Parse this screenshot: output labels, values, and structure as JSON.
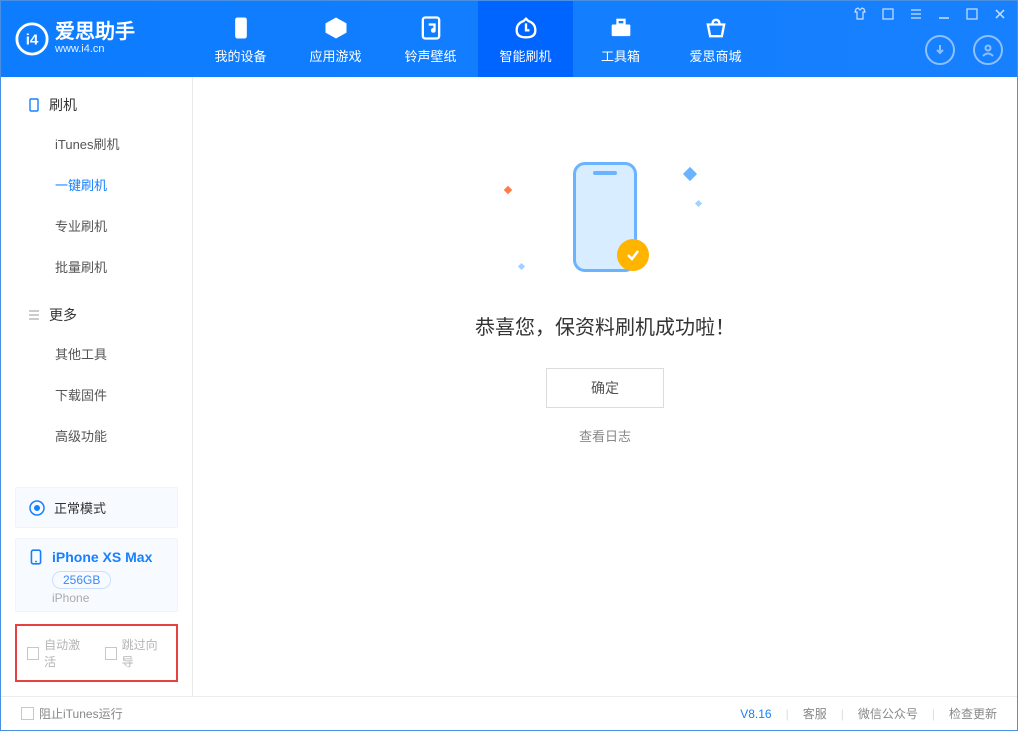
{
  "app": {
    "name_cn": "爱思助手",
    "name_en": "www.i4.cn"
  },
  "tabs": {
    "device": "我的设备",
    "apps": "应用游戏",
    "ring": "铃声壁纸",
    "flash": "智能刷机",
    "tools": "工具箱",
    "store": "爱思商城"
  },
  "sidebar": {
    "group_flash": "刷机",
    "items_flash": {
      "itunes": "iTunes刷机",
      "oneclick": "一键刷机",
      "pro": "专业刷机",
      "batch": "批量刷机"
    },
    "group_more": "更多",
    "items_more": {
      "other": "其他工具",
      "firmware": "下载固件",
      "advanced": "高级功能"
    }
  },
  "status": {
    "mode": "正常模式"
  },
  "device": {
    "name": "iPhone XS Max",
    "capacity": "256GB",
    "type": "iPhone"
  },
  "options": {
    "auto_activate": "自动激活",
    "skip_guide": "跳过向导"
  },
  "main": {
    "success": "恭喜您，保资料刷机成功啦！",
    "confirm": "确定",
    "view_log": "查看日志"
  },
  "footer": {
    "block_itunes": "阻止iTunes运行",
    "version": "V8.16",
    "support": "客服",
    "wechat": "微信公众号",
    "update": "检查更新"
  }
}
